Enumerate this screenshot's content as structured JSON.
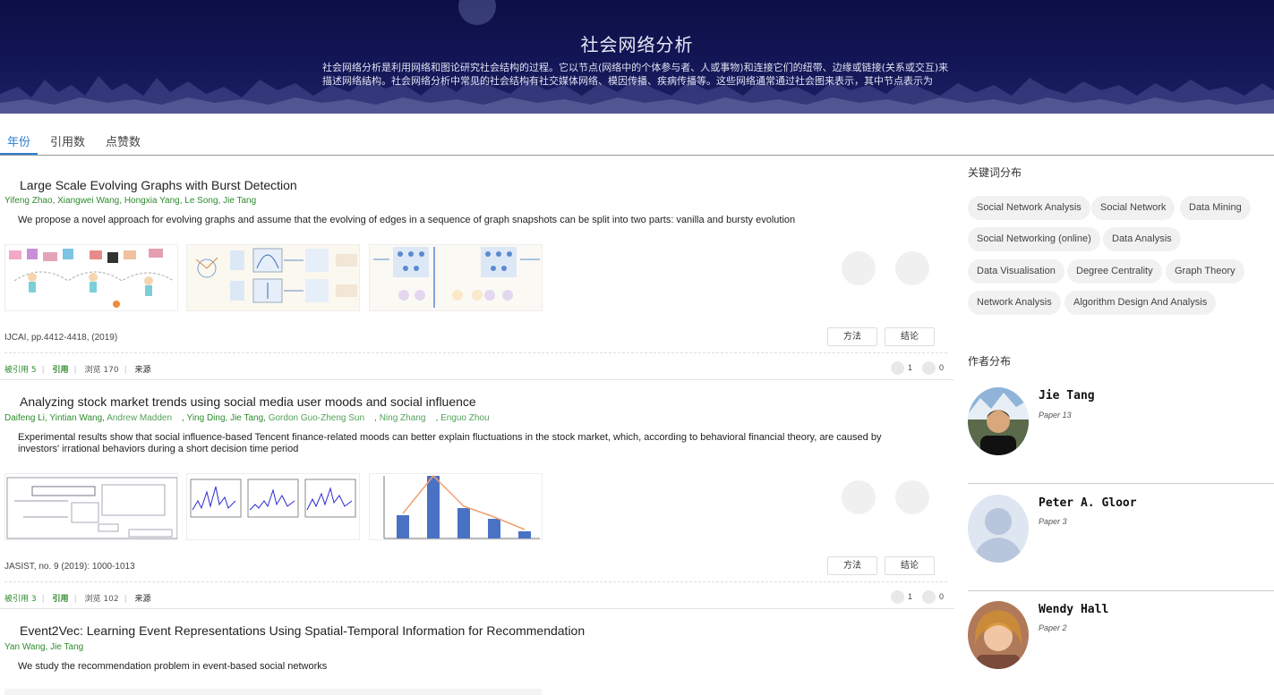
{
  "banner": {
    "title": "社会网络分析",
    "description": "社会网络分析是利用网络和图论研究社会结构的过程。它以节点(网络中的个体参与者、人或事物)和连接它们的纽带、边缘或链接(关系或交互)来描述网络结构。社会网络分析中常见的社会结构有社交媒体网络、模因传播、疾病传播等。这些网络通常通过社会图来表示，其中节点表示为点，纽带表示为"
  },
  "tabs": [
    {
      "label": "年份",
      "active": true
    },
    {
      "label": "引用数",
      "active": false
    },
    {
      "label": "点赞数",
      "active": false
    }
  ],
  "papers": [
    {
      "title": "Large Scale Evolving Graphs with Burst Detection",
      "authors": [
        "Yifeng Zhao",
        "Xiangwei Wang",
        "Hongxia Yang",
        "Le Song",
        "Jie Tang"
      ],
      "abstract": "We propose a novel approach for evolving graphs and assume that the evolving of edges in a sequence of graph snapshots can be split into two parts: vanilla and bursty evolution",
      "venue": "IJCAI, pp.4412-4418, (2019)",
      "method_label": "方法",
      "conclusion_label": "结论",
      "cited_label": "被引用",
      "cited_count": "5",
      "cite_label": "引用",
      "views_label": "浏览",
      "views": "170",
      "source_label": "来源",
      "likes": "1",
      "dislikes": "0"
    },
    {
      "title": "Analyzing stock market trends using social media user moods and social influence",
      "authors": [
        "Daifeng Li",
        "Yintian Wang",
        "Andrew Madden",
        "Ying Ding",
        "Jie Tang",
        "Gordon Guo-Zheng Sun",
        "Ning Zhang",
        "Enguo Zhou"
      ],
      "abstract": "Experimental results show that social influence-based Tencent finance-related moods can better explain fluctuations in the stock market, which, according to behavioral financial theory, are caused by investors'   irrational behaviors during a short decision time period",
      "venue": "JASIST, no. 9 (2019): 1000-1013",
      "method_label": "方法",
      "conclusion_label": "结论",
      "cited_label": "被引用",
      "cited_count": "3",
      "cite_label": "引用",
      "views_label": "浏览",
      "views": "102",
      "source_label": "来源",
      "likes": "1",
      "dislikes": "0"
    },
    {
      "title": "Event2Vec: Learning Event Representations Using Spatial-Temporal Information for Recommendation",
      "authors": [
        "Yan Wang",
        "Jie Tang"
      ],
      "abstract": "We study the recommendation problem in event-based social networks"
    }
  ],
  "sidebar": {
    "keywords_heading": "关键词分布",
    "keywords": [
      "Social Network Analysis",
      "Social Network",
      "Data Mining",
      "Social Networking (online)",
      "Data Analysis",
      "Data Visualisation",
      "Degree Centrality",
      "Graph Theory",
      "Network Analysis",
      "Algorithm Design And Analysis"
    ],
    "authors_heading": "作者分布",
    "authors": [
      {
        "name": "Jie Tang",
        "papers": "Paper 13"
      },
      {
        "name": "Peter A. Gloor",
        "papers": "Paper 3"
      },
      {
        "name": "Wendy Hall",
        "papers": "Paper 2"
      }
    ]
  },
  "colors": {
    "accent": "#2e7dd1",
    "author_green": "#2e8b2e",
    "banner": "#0c0f45"
  }
}
